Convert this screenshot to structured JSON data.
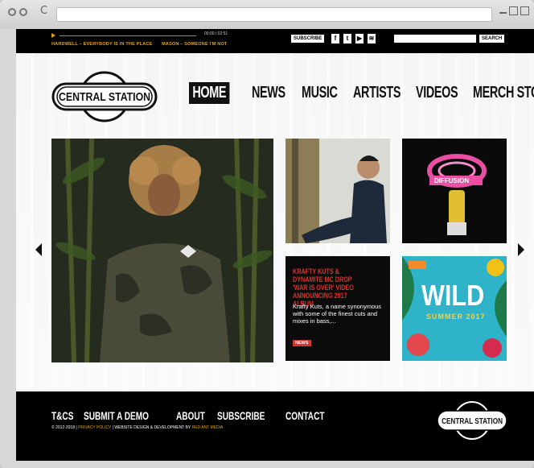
{
  "browser": {
    "back_icon": "back-circle-icon",
    "forward_icon": "forward-circle-icon",
    "reload_glyph": "C",
    "url": ""
  },
  "topbar": {
    "timecode": "00:00 / 02:51",
    "tracks": [
      "HARDWELL – EVERYBODY IS IN THE PLACE",
      "MASON – SOMEONE I'M NOT"
    ],
    "subscribe_label": "SUBSCRIBE",
    "social": [
      {
        "name": "facebook-icon",
        "glyph": "f"
      },
      {
        "name": "twitter-icon",
        "glyph": "t"
      },
      {
        "name": "youtube-icon",
        "glyph": "▶"
      },
      {
        "name": "rss-icon",
        "glyph": "≋"
      }
    ],
    "search_placeholder": "",
    "search_label": "SEARCH"
  },
  "brand": {
    "logo_text": "CENTRAL STATION"
  },
  "nav": {
    "items": [
      "HOME",
      "NEWS",
      "MUSIC",
      "ARTISTS",
      "VIDEOS",
      "MERCH STORE"
    ],
    "active": "HOME"
  },
  "tiles": {
    "diffusion_label": "DIFFUSION",
    "news": {
      "headline": "KRAFTY KUTS & DYNAMITE MC DROP 'WAR IS OVER' VIDEO ANNOUNCING 2017 ALBUM",
      "text": "Krafty Kuts, a name synonymous with some of the finest cuts and mixes in bass,...",
      "badge": "NEWS"
    },
    "wild": {
      "title": "WILD",
      "subtitle": "SUMMER 2017"
    }
  },
  "footer": {
    "links": [
      "T&CS",
      "SUBMIT A DEMO",
      "ABOUT",
      "SUBSCRIBE",
      "CONTACT"
    ],
    "copyright": "© 2012-2018 | ",
    "privacy": "PRIVACY POLICY",
    "credit": " | WEBSITE DESIGN & DEVELOPMENT BY ",
    "agency": "RED ANT MEDIA"
  },
  "colors": {
    "accent": "#e0a020",
    "news_red": "#d6352e",
    "black": "#000000"
  }
}
